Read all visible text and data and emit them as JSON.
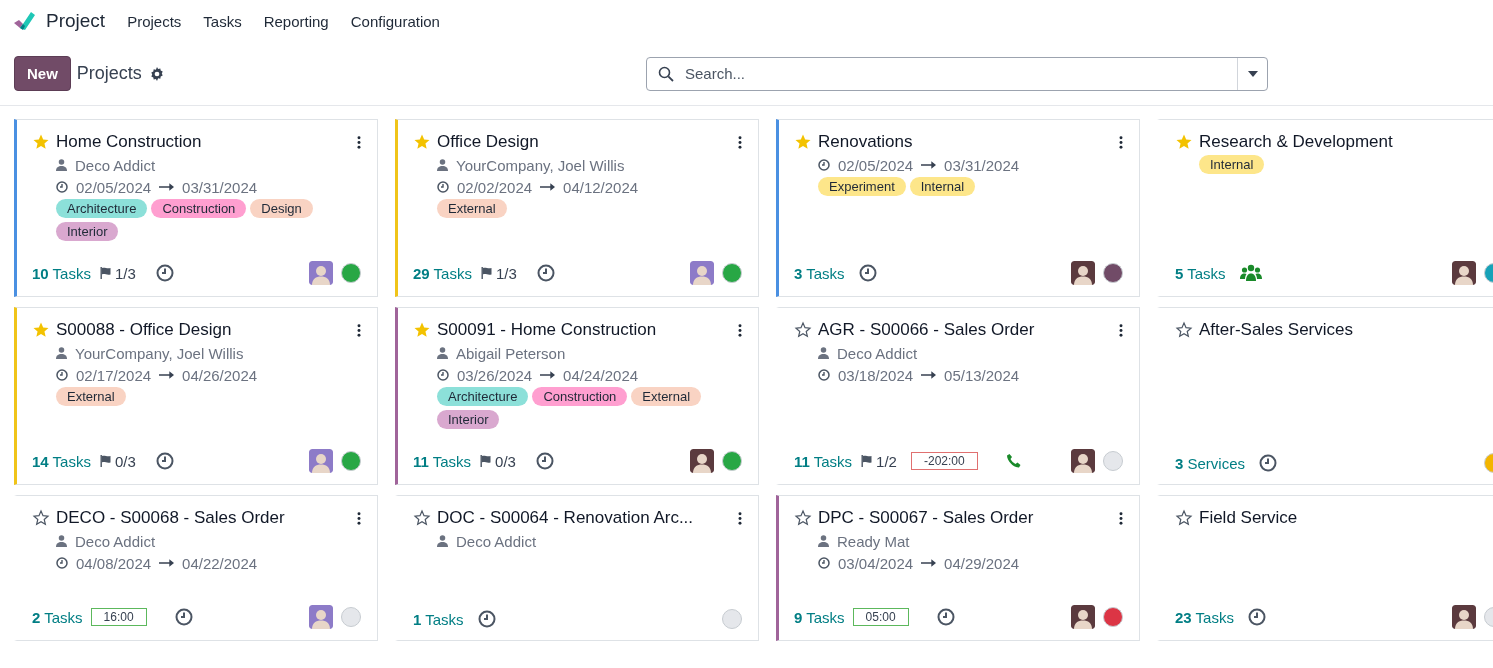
{
  "app": {
    "name": "Project"
  },
  "menu": [
    "Projects",
    "Tasks",
    "Reporting",
    "Configuration"
  ],
  "control_panel": {
    "new_button": "New",
    "breadcrumb": "Projects"
  },
  "search": {
    "placeholder": "Search..."
  },
  "cards": [
    {
      "title": "Home Construction",
      "favorite": true,
      "menu": true,
      "color": "#4a90e2",
      "partner": "Deco Addict",
      "start": "02/05/2024",
      "end": "03/31/2024",
      "tags": [
        {
          "label": "Architecture",
          "color": "#8ce0d9"
        },
        {
          "label": "Construction",
          "color": "#ff9fd0"
        },
        {
          "label": "Design",
          "color": "#f9d3c3"
        },
        {
          "label": "Interior",
          "color": "#d9a8cf"
        }
      ],
      "count": "**10** Tasks",
      "milestones": "1/3",
      "activity": {
        "kind": "clock"
      },
      "avatar": {
        "color": "#8d7bc8"
      },
      "status": {
        "color": "#28a745"
      }
    },
    {
      "title": "Office Design",
      "favorite": true,
      "menu": true,
      "color": "#f0c419",
      "partner": "YourCompany, Joel Willis",
      "start": "02/02/2024",
      "end": "04/12/2024",
      "tags": [
        {
          "label": "External",
          "color": "#f9d3c3"
        }
      ],
      "count": "**29** Tasks",
      "milestones": "1/3",
      "activity": {
        "kind": "clock"
      },
      "avatar": {
        "color": "#8d7bc8"
      },
      "status": {
        "color": "#28a745"
      }
    },
    {
      "title": "Renovations",
      "favorite": true,
      "menu": true,
      "color": "#4a90e2",
      "start": "02/05/2024",
      "end": "03/31/2024",
      "tags": [
        {
          "label": "Experiment",
          "color": "#fde68a"
        },
        {
          "label": "Internal",
          "color": "#fde68a"
        }
      ],
      "count": "**3** Tasks",
      "activity": {
        "kind": "clock"
      },
      "avatar": {
        "color": "#5b3a3e"
      },
      "status": {
        "color": "#714b67"
      }
    },
    {
      "title": "Research & Development",
      "favorite": true,
      "menu": false,
      "tags": [
        {
          "label": "Internal",
          "color": "#fde68a"
        }
      ],
      "count": "**5** Tasks",
      "activity": {
        "kind": "group"
      },
      "avatar": {
        "color": "#5b3a3e"
      },
      "status": {
        "color": "#17a2b8"
      }
    },
    {
      "title": "S00088 - Office Design",
      "favorite": true,
      "menu": true,
      "color": "#f0c419",
      "partner": "YourCompany, Joel Willis",
      "start": "02/17/2024",
      "end": "04/26/2024",
      "tags": [
        {
          "label": "External",
          "color": "#f9d3c3"
        }
      ],
      "count": "**14** Tasks",
      "milestones": "0/3",
      "activity": {
        "kind": "clock"
      },
      "avatar": {
        "color": "#8d7bc8"
      },
      "status": {
        "color": "#28a745"
      }
    },
    {
      "title": "S00091 - Home Construction",
      "favorite": true,
      "menu": true,
      "color": "#a0649a",
      "partner": "Abigail Peterson",
      "start": "03/26/2024",
      "end": "04/24/2024",
      "tags": [
        {
          "label": "Architecture",
          "color": "#8ce0d9"
        },
        {
          "label": "Construction",
          "color": "#ff9fd0"
        },
        {
          "label": "External",
          "color": "#f9d3c3"
        },
        {
          "label": "Interior",
          "color": "#d9a8cf"
        }
      ],
      "count": "**11** Tasks",
      "milestones": "0/3",
      "activity": {
        "kind": "clock"
      },
      "avatar": {
        "color": "#5b3a3e"
      },
      "status": {
        "color": "#28a745"
      }
    },
    {
      "title": "AGR - S00066 - Sales Order",
      "favorite": false,
      "menu": true,
      "partner": "Deco Addict",
      "start": "03/18/2024",
      "end": "05/13/2024",
      "count": "**11** Tasks",
      "milestones": "1/2",
      "timer": {
        "text": "-202:00",
        "kind": "overdue"
      },
      "activity": {
        "kind": "phone"
      },
      "avatar": {
        "color": "#5b3a3e"
      },
      "status": {
        "color": "#e5e7eb"
      }
    },
    {
      "title": "After-Sales Services",
      "favorite": false,
      "menu": false,
      "count": "**3** Services",
      "activity": {
        "kind": "clock"
      },
      "status": {
        "color": "#f3b500"
      }
    },
    {
      "title": "DECO - S00068 - Sales Order",
      "favorite": false,
      "menu": true,
      "partner": "Deco Addict",
      "start": "04/08/2024",
      "end": "04/22/2024",
      "count": "**2** Tasks",
      "timer": {
        "text": "16:00",
        "kind": "planned"
      },
      "activity": {
        "kind": "clock"
      },
      "avatar": {
        "color": "#8d7bc8"
      },
      "status": {
        "color": "#e5e7eb"
      }
    },
    {
      "title": "DOC - S00064 - Renovation Arc...",
      "favorite": false,
      "menu": true,
      "partner": "Deco Addict",
      "count": "**1** Tasks",
      "activity": {
        "kind": "clock"
      },
      "status": {
        "color": "#e5e7eb"
      }
    },
    {
      "title": "DPC - S00067 - Sales Order",
      "favorite": false,
      "menu": true,
      "color": "#a0649a",
      "partner": "Ready Mat",
      "start": "03/04/2024",
      "end": "04/29/2024",
      "count": "**9** Tasks",
      "timer": {
        "text": "05:00",
        "kind": "planned"
      },
      "activity": {
        "kind": "clock"
      },
      "avatar": {
        "color": "#5b3a3e"
      },
      "status": {
        "color": "#dc3545"
      }
    },
    {
      "title": "Field Service",
      "favorite": false,
      "menu": false,
      "count": "**23** Tasks",
      "activity": {
        "kind": "clock"
      },
      "avatar": {
        "color": "#5b3a3e"
      },
      "status": {
        "color": "#e5e7eb"
      }
    }
  ]
}
